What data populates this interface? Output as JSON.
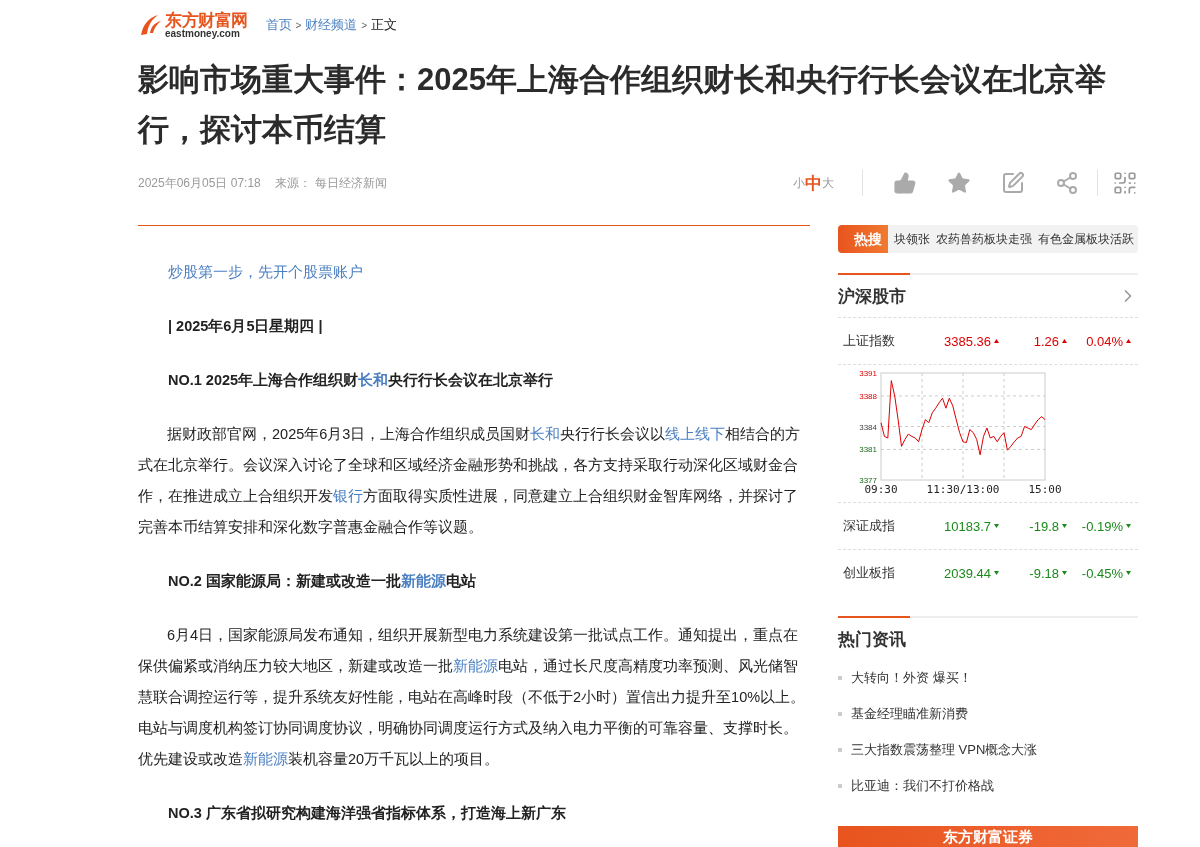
{
  "header": {
    "logo": {
      "name": "东方财富网",
      "domain": "eastmoney.com"
    },
    "breadcrumbs": [
      {
        "label": "首页",
        "link": true
      },
      {
        "label": "财经频道",
        "link": true
      },
      {
        "label": "正文",
        "link": false
      }
    ],
    "separator": ">"
  },
  "article": {
    "title": "影响市场重大事件：2025年上海合作组织财长和央行行长会议在北京举行，探讨本币结算",
    "date": "2025年06月05日 07:18",
    "source_label": "来源：",
    "source": "每日经济新闻",
    "font_sizes": [
      {
        "label": "小",
        "selected": false
      },
      {
        "label": "中",
        "selected": true
      },
      {
        "label": "大",
        "selected": false
      }
    ],
    "blocks": [
      {
        "kind": "promo",
        "segments": [
          {
            "text": "炒股第一步，先开个股票账户",
            "link": true
          }
        ]
      },
      {
        "kind": "heading",
        "segments": [
          {
            "text": "| 2025年6月5日星期四 |",
            "link": false
          }
        ]
      },
      {
        "kind": "heading",
        "segments": [
          {
            "text": "NO.1 2025年上海合作组织财",
            "link": false
          },
          {
            "text": "长和",
            "link": true
          },
          {
            "text": "央行行长会议在北京举行",
            "link": false
          }
        ]
      },
      {
        "kind": "paragraph",
        "segments": [
          {
            "text": "据财政部官网，2025年6月3日，上海合作组织成员国财",
            "link": false
          },
          {
            "text": "长和",
            "link": true
          },
          {
            "text": "央行行长会议以",
            "link": false
          },
          {
            "text": "线上线下",
            "link": true
          },
          {
            "text": "相结合的方式在北京举行。会议深入讨论了全球和区域经济金融形势和挑战，各方支持采取行动深化区域财金合作，在推进成立上合组织开发",
            "link": false
          },
          {
            "text": "银行",
            "link": true
          },
          {
            "text": "方面取得实质性进展，同意建立上合组织财金智库网络，并探讨了完善本币结算安排和深化数字普惠金融合作等议题。",
            "link": false
          }
        ]
      },
      {
        "kind": "heading",
        "segments": [
          {
            "text": "NO.2 国家能源局：新建或改造一批",
            "link": false
          },
          {
            "text": "新能源",
            "link": true
          },
          {
            "text": "电站",
            "link": false
          }
        ]
      },
      {
        "kind": "paragraph",
        "segments": [
          {
            "text": "6月4日，国家能源局发布通知，组织开展新型电力系统建设第一批试点工作。通知提出，重点在保供偏紧或消纳压力较大地区，新建或改造一批",
            "link": false
          },
          {
            "text": "新能源",
            "link": true
          },
          {
            "text": "电站，通过长尺度高精度功率预测、风光储智慧联合调控运行等，提升系统友好性能，电站在高峰时段（不低于2小时）置信出力提升至10%以上。电站与调度机构签订协同调度协议，明确协同调度运行方式及纳入电力平衡的可靠容量、支撑时长。优先建设或改造",
            "link": false
          },
          {
            "text": "新能源",
            "link": true
          },
          {
            "text": "装机容量20万千瓦以上的项目。",
            "link": false
          }
        ]
      },
      {
        "kind": "heading",
        "segments": [
          {
            "text": "NO.3 广东省拟研究构建海洋强省指标体系，打造海上新广东",
            "link": false
          }
        ]
      }
    ]
  },
  "sidebar": {
    "hot_search": {
      "label": "热搜",
      "items": [
        "块领张",
        "农药兽药板块走强",
        "有色金属板块活跃"
      ]
    },
    "market": {
      "title": "沪深股市",
      "indices": [
        {
          "name": "上证指数",
          "value": "3385.36",
          "change": "1.26",
          "percent": "0.04%",
          "kind": "up"
        },
        {
          "name": "深证成指",
          "value": "10183.7",
          "change": "-19.8",
          "percent": "-0.19%",
          "kind": "down"
        },
        {
          "name": "创业板指",
          "value": "2039.44",
          "change": "-9.18",
          "percent": "-0.45%",
          "kind": "down"
        }
      ],
      "chart_data": {
        "type": "line",
        "categories": [
          "09:30",
          null,
          null,
          null,
          null,
          null,
          null,
          null,
          null,
          null,
          null,
          null,
          null,
          null,
          null,
          null,
          null,
          null,
          null,
          null,
          null,
          null,
          null,
          null,
          "11:30/13:00",
          null,
          null,
          null,
          null,
          null,
          null,
          null,
          null,
          null,
          null,
          null,
          null,
          null,
          null,
          null,
          null,
          null,
          null,
          null,
          null,
          null,
          null,
          null,
          "15:00"
        ],
        "series": [
          {
            "color": "#dd0000",
            "values": [
              3384.5,
              3382.7,
              3382.5,
              3390,
              3388,
              3384.9,
              3381.4,
              3382.3,
              3383,
              3382.7,
              3382.5,
              3382,
              3383.6,
              3384.9,
              3384.5,
              3385.8,
              3386.4,
              3387.1,
              3387.7,
              3386.4,
              3387.7,
              3386.7,
              3384.9,
              3383.2,
              3382,
              3381.9,
              3383.6,
              3383.2,
              3382.3,
              3380.3,
              3382.7,
              3383.8,
              3382.5,
              3382.7,
              3382,
              3382.7,
              3383.2,
              3380.9,
              3381.4,
              3382,
              3382.5,
              3382.7,
              3384,
              3383.8,
              3383.6,
              3384.3,
              3384.9,
              3385.3,
              3384.9
            ]
          }
        ],
        "grid": true,
        "ylim": [
          3377,
          3391
        ],
        "yticks": [
          3377,
          3381,
          3384,
          3388,
          3391
        ]
      }
    },
    "news": {
      "title": "热门资讯",
      "items": [
        "大转向！外资 爆买！",
        "基金经理瞄准新消费",
        "三大指数震荡整理 VPN概念大涨",
        "比亚迪：我们不打价格战"
      ]
    },
    "banner": {
      "label": "东方财富证券"
    }
  }
}
